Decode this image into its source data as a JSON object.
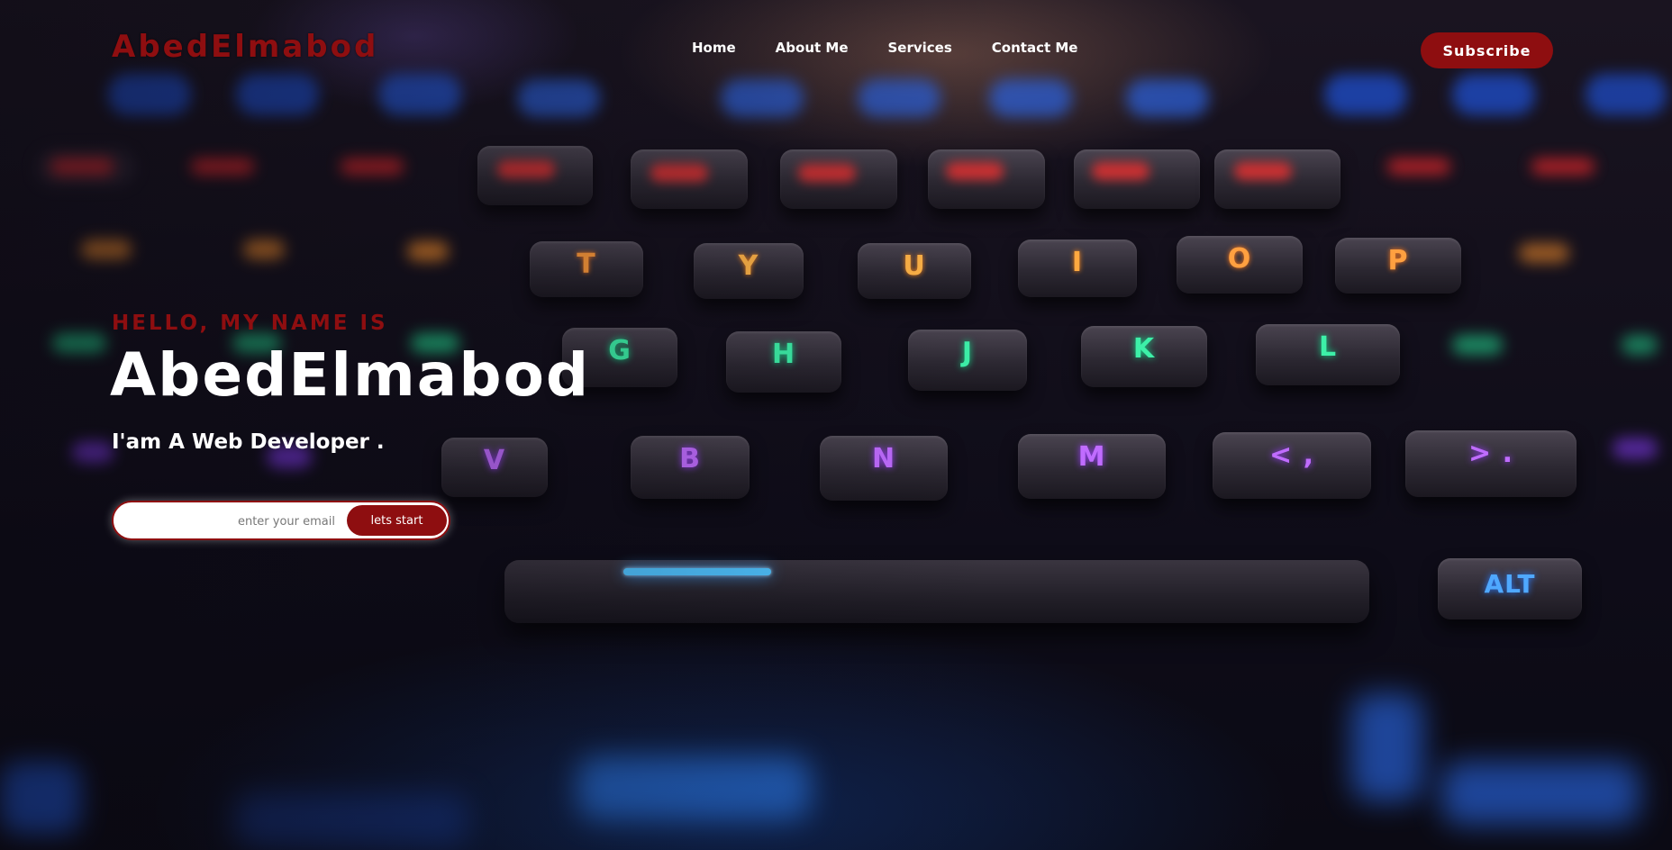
{
  "brand": "AbedElmabod",
  "nav": {
    "links": [
      "Home",
      "About Me",
      "Services",
      "Contact Me"
    ],
    "subscribe_label": "Subscribe"
  },
  "hero": {
    "greeting": "HELLO, MY NAME IS",
    "name": "AbedElmabod",
    "subtitle": "I'am A Web Developer ."
  },
  "signup": {
    "email_placeholder": "enter your email",
    "email_value": "",
    "button_label": "lets start"
  },
  "colors": {
    "accent": "#8e0e10",
    "text": "#ffffff"
  },
  "background": {
    "description_icon": "backlit-keyboard-photo"
  }
}
